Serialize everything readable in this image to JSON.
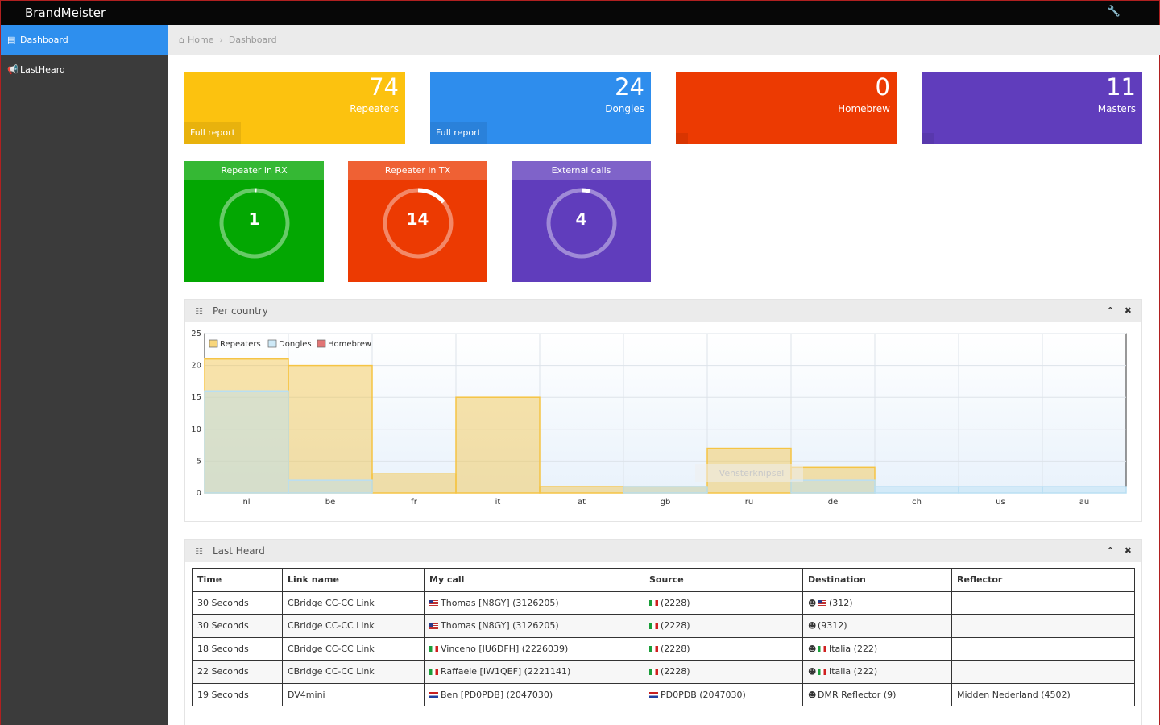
{
  "app": {
    "title": "BrandMeister"
  },
  "sidebar": {
    "items": [
      {
        "label": "Dashboard",
        "icon": "bar-chart-icon"
      },
      {
        "label": "LastHeard",
        "icon": "bullhorn-icon"
      }
    ]
  },
  "breadcrumb": {
    "home": "Home",
    "current": "Dashboard"
  },
  "stats": [
    {
      "value": "74",
      "label": "Repeaters",
      "footer": "Full report",
      "color": "#fcc20f"
    },
    {
      "value": "24",
      "label": "Dongles",
      "footer": "Full report",
      "color": "#2e8ded"
    },
    {
      "value": "0",
      "label": "Homebrew",
      "footer": "",
      "color": "#ec3a02"
    },
    {
      "value": "11",
      "label": "Masters",
      "footer": "",
      "color": "#603dbc"
    }
  ],
  "gauges": [
    {
      "title": "Repeater in RX",
      "value": "1",
      "fraction": 0.01,
      "color": "#03a702"
    },
    {
      "title": "Repeater in TX",
      "value": "14",
      "fraction": 0.14,
      "color": "#ec3a02"
    },
    {
      "title": "External calls",
      "value": "4",
      "fraction": 0.04,
      "color": "#603dbc"
    }
  ],
  "per_country": {
    "title": "Per country",
    "watermark": "Vensterknipsel"
  },
  "chart_data": {
    "type": "area",
    "categories": [
      "nl",
      "be",
      "fr",
      "it",
      "at",
      "gb",
      "ru",
      "de",
      "ch",
      "us",
      "au"
    ],
    "series": [
      {
        "name": "Repeaters",
        "values": [
          21,
          20,
          3,
          15,
          1,
          1,
          7,
          4,
          0,
          0,
          0
        ],
        "color": "#f5c444"
      },
      {
        "name": "Dongles",
        "values": [
          16,
          2,
          0,
          0,
          0,
          1,
          0,
          2,
          1,
          1,
          1
        ],
        "color": "#b9dff3"
      },
      {
        "name": "Homebrew",
        "values": [
          0,
          0,
          0,
          0,
          0,
          0,
          0,
          0,
          0,
          0,
          0
        ],
        "color": "#d63b3b"
      }
    ],
    "yticks": [
      "0",
      "5",
      "10",
      "15",
      "20",
      "25"
    ],
    "ylim": [
      0,
      25
    ],
    "legend": "top-left",
    "grid": true
  },
  "last_heard": {
    "title": "Last Heard",
    "columns": [
      "Time",
      "Link name",
      "My call",
      "Source",
      "Destination",
      "Reflector"
    ],
    "rows": [
      {
        "time": "30 Seconds",
        "link": "CBridge CC-CC Link",
        "call_flag": "us",
        "call": "Thomas [N8GY] (3126205)",
        "src_flag": "it",
        "source": "(2228)",
        "dst_flag": "us",
        "destination": "(312)",
        "reflector": ""
      },
      {
        "time": "30 Seconds",
        "link": "CBridge CC-CC Link",
        "call_flag": "us",
        "call": "Thomas [N8GY] (3126205)",
        "src_flag": "it",
        "source": "(2228)",
        "dst_flag": "",
        "destination": "(9312)",
        "reflector": ""
      },
      {
        "time": "18 Seconds",
        "link": "CBridge CC-CC Link",
        "call_flag": "it",
        "call": "Vinceno [IU6DFH] (2226039)",
        "src_flag": "it",
        "source": "(2228)",
        "dst_flag": "it",
        "destination": "Italia (222)",
        "reflector": ""
      },
      {
        "time": "22 Seconds",
        "link": "CBridge CC-CC Link",
        "call_flag": "it",
        "call": "Raffaele [IW1QEF] (2221141)",
        "src_flag": "it",
        "source": "(2228)",
        "dst_flag": "it",
        "destination": "Italia (222)",
        "reflector": ""
      },
      {
        "time": "19 Seconds",
        "link": "DV4mini",
        "call_flag": "nl",
        "call": "Ben [PD0PDB] (2047030)",
        "src_flag": "nl",
        "source": "PD0PDB (2047030)",
        "dst_flag": "",
        "destination": "DMR Reflector (9)",
        "reflector": "Midden Nederland (4502)"
      }
    ]
  }
}
